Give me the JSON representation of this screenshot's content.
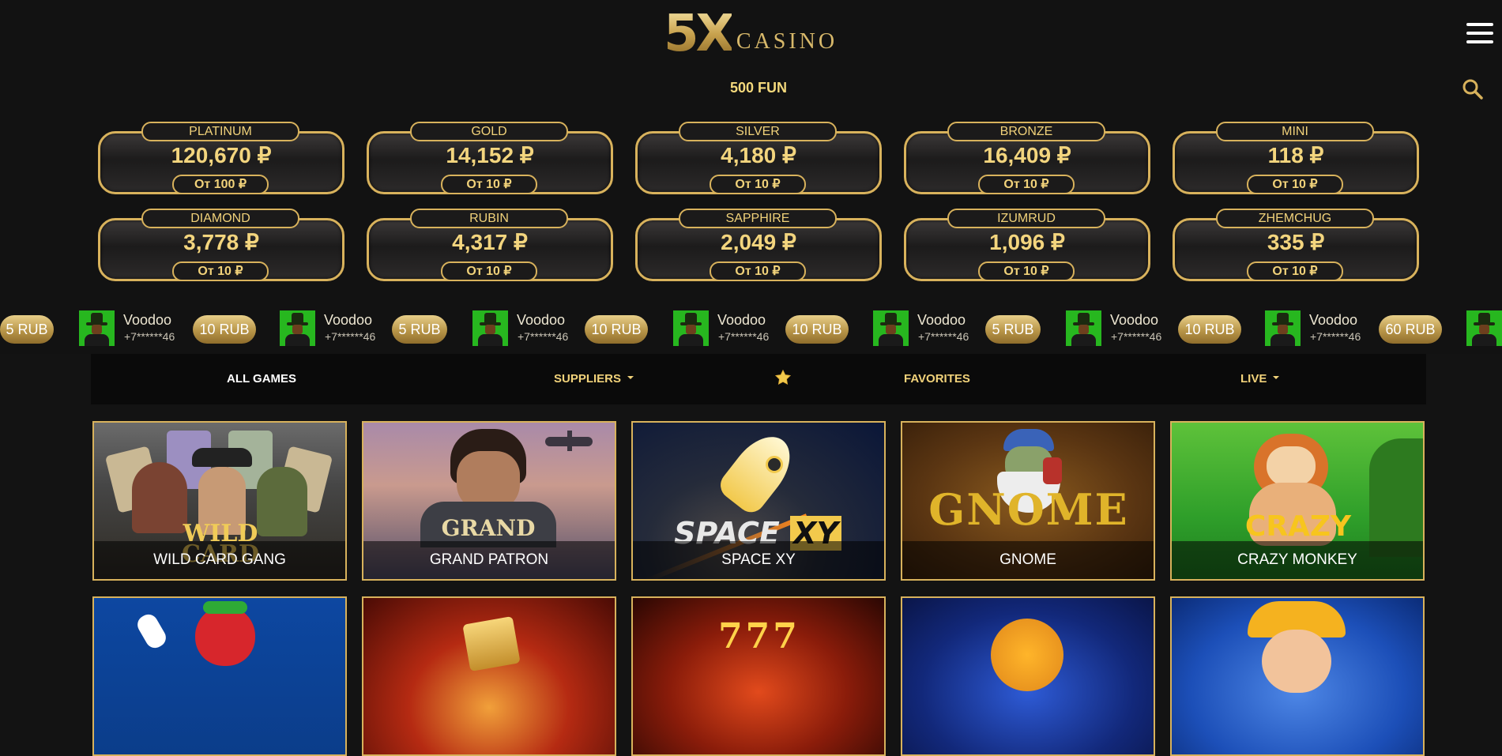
{
  "header": {
    "logo_mark": "5X",
    "logo_word": "CASINO",
    "balance": "500 FUN",
    "menu_icon": "hamburger-menu-icon",
    "search_icon": "search-icon"
  },
  "jackpots": [
    {
      "name": "PLATINUM",
      "amount": "120,670 ₽",
      "min": "От 100 ₽"
    },
    {
      "name": "GOLD",
      "amount": "14,152 ₽",
      "min": "От 10 ₽"
    },
    {
      "name": "SILVER",
      "amount": "4,180 ₽",
      "min": "От 10 ₽"
    },
    {
      "name": "BRONZE",
      "amount": "16,409 ₽",
      "min": "От 10 ₽"
    },
    {
      "name": "MINI",
      "amount": "118 ₽",
      "min": "От 10 ₽"
    },
    {
      "name": "DIAMOND",
      "amount": "3,778 ₽",
      "min": "От 10 ₽"
    },
    {
      "name": "RUBIN",
      "amount": "4,317 ₽",
      "min": "От 10 ₽"
    },
    {
      "name": "SAPPHIRE",
      "amount": "2,049 ₽",
      "min": "От 10 ₽"
    },
    {
      "name": "IZUMRUD",
      "amount": "1,096 ₽",
      "min": "От 10 ₽"
    },
    {
      "name": "ZHEMCHUG",
      "amount": "335 ₽",
      "min": "От 10 ₽"
    }
  ],
  "ticker": {
    "lead_amount": "5 RUB",
    "wins": [
      {
        "game": "Voodoo",
        "phone": "+7******46",
        "amount": "10 RUB"
      },
      {
        "game": "Voodoo",
        "phone": "+7******46",
        "amount": "5 RUB"
      },
      {
        "game": "Voodoo",
        "phone": "+7******46",
        "amount": "10 RUB"
      },
      {
        "game": "Voodoo",
        "phone": "+7******46",
        "amount": "10 RUB"
      },
      {
        "game": "Voodoo",
        "phone": "+7******46",
        "amount": "5 RUB"
      },
      {
        "game": "Voodoo",
        "phone": "+7******46",
        "amount": "10 RUB"
      },
      {
        "game": "Voodoo",
        "phone": "+7******46",
        "amount": "60 RUB"
      }
    ]
  },
  "nav": {
    "all_games": "ALL GAMES",
    "suppliers": "SUPPLIERS",
    "favorites_icon": "star-icon",
    "favorites": "FAVORITES",
    "live": "LIVE"
  },
  "games": [
    {
      "title": "WILD CARD GANG"
    },
    {
      "title": "GRAND PATRON"
    },
    {
      "title": "SPACE XY"
    },
    {
      "title": "GNOME"
    },
    {
      "title": "CRAZY MONKEY"
    },
    {
      "title": ""
    },
    {
      "title": ""
    },
    {
      "title": ""
    },
    {
      "title": ""
    },
    {
      "title": ""
    }
  ],
  "colors": {
    "gold": "#d8b25c",
    "gold_text": "#f1d27a",
    "background": "#131313",
    "nav_background": "#0a0a0a"
  }
}
